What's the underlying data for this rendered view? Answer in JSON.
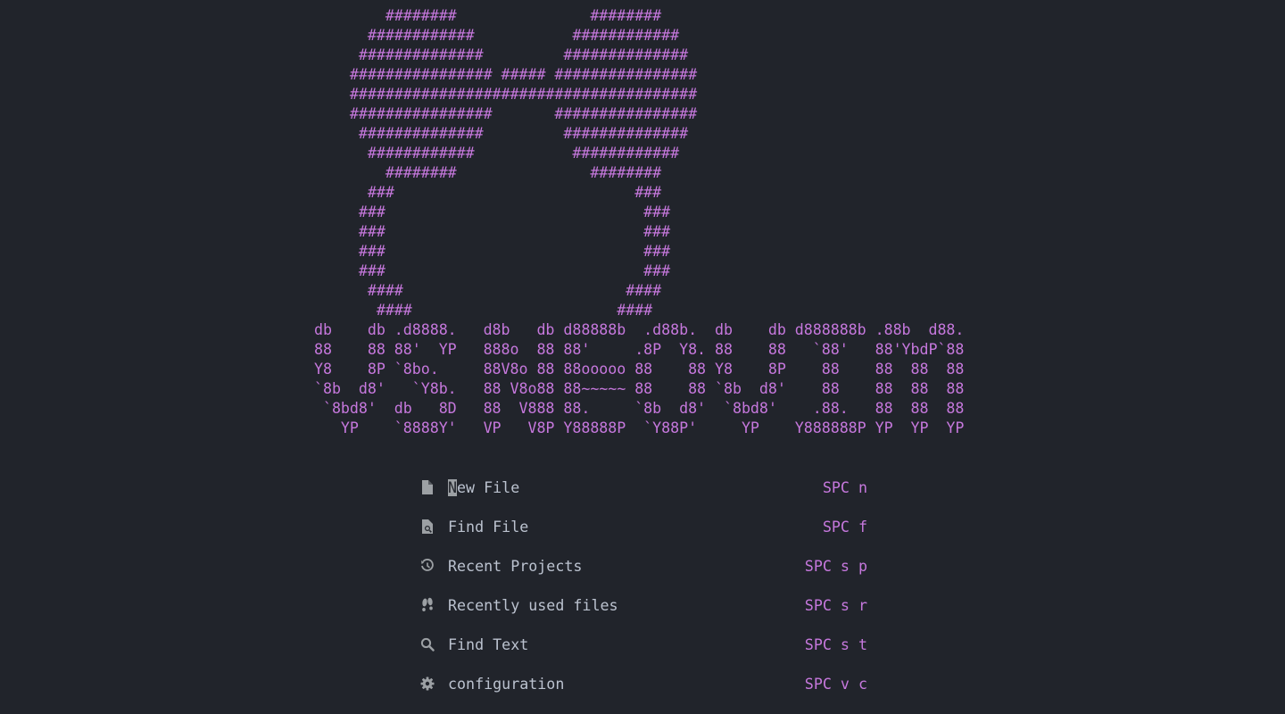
{
  "banner": {
    "ascii_art": "        ########               ########\n      ############           ############\n     ##############         ##############\n    ################ ##### ################\n    #######################################\n    ################       ################\n     ##############         ##############\n      ############           ############\n        ########               ########\n      ###                           ###\n     ###                             ###\n     ###                             ###\n     ###                             ###\n     ###                             ###\n      ####                         ####\n       ####                       ####\ndb    db .d8888.   d8b   db d88888b  .d88b.  db    db d888888b .88b  d88.\n88    88 88'  YP   888o  88 88'     .8P  Y8. 88    88   `88'   88'YbdP`88\nY8    8P `8bo.     88V8o 88 88ooooo 88    88 Y8    8P    88    88  88  88\n`8b  d8'   `Y8b.   88 V8o88 88~~~~~ 88    88 `8b  d8'    88    88  88  88\n `8bd8'  db   8D   88  V888 88.     `8b  d8'  `8bd8'    .88.   88  88  88\n   YP    `8888Y'   VP   V8P Y88888P  `Y88P'     YP    Y888888P YP  YP  YP"
  },
  "menu": [
    {
      "icon": "file-icon",
      "label_first": "N",
      "label_rest": "ew File",
      "key": "SPC n"
    },
    {
      "icon": "find-file-icon",
      "label": "Find File",
      "key": "SPC f"
    },
    {
      "icon": "history-icon",
      "label": "Recent Projects",
      "key": "SPC s p"
    },
    {
      "icon": "footprints-icon",
      "label": "Recently used files",
      "key": "SPC s r"
    },
    {
      "icon": "search-icon",
      "label": "Find Text",
      "key": "SPC s t"
    },
    {
      "icon": "gear-icon",
      "label": "configuration",
      "key": "SPC v c"
    }
  ],
  "colors": {
    "background": "#21242b",
    "accent": "#c678dd",
    "text": "#bbc2cf",
    "cursor": "#9ca0a4"
  }
}
